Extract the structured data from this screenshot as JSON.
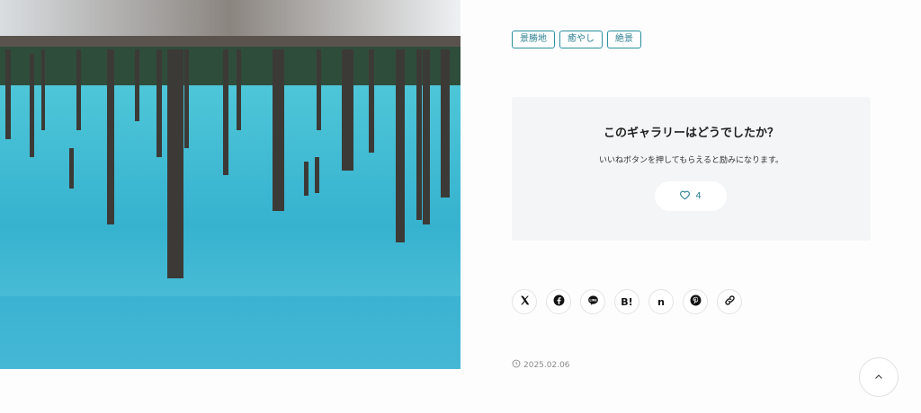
{
  "photo": {
    "subject": "blue-pond-with-dead-trees",
    "colors": {
      "water": "#3fb5cf",
      "water_dark": "#1f93b2",
      "snow": "#e9ecee",
      "forest": "#2d4a38"
    }
  },
  "tags": [
    "景勝地",
    "癒やし",
    "絶景"
  ],
  "feedback": {
    "title": "このギャラリーはどうでしたか？",
    "subtitle": "いいねボタンを押してもらえると励みになります。",
    "like_count": "4",
    "like_icon": "heart-icon"
  },
  "share": [
    {
      "name": "x",
      "icon": "x-logo-icon"
    },
    {
      "name": "facebook",
      "icon": "facebook-icon"
    },
    {
      "name": "line",
      "icon": "line-icon"
    },
    {
      "name": "hatena",
      "icon": "hatena-bookmark-icon",
      "label": "B!"
    },
    {
      "name": "note",
      "icon": "note-icon",
      "label": "n"
    },
    {
      "name": "pinterest",
      "icon": "pinterest-icon"
    },
    {
      "name": "copy-link",
      "icon": "link-icon"
    }
  ],
  "date": {
    "icon": "clock-icon",
    "text": "2025.02.06"
  },
  "accent": "#2a8fa0"
}
